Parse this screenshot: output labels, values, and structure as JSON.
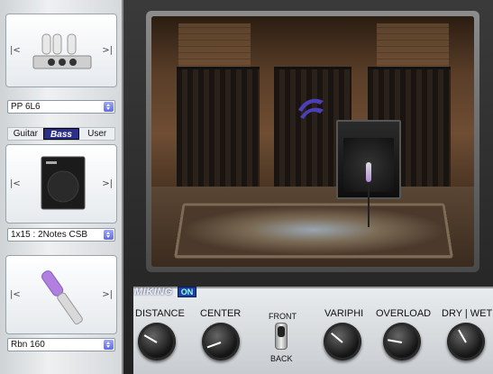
{
  "left": {
    "amp_head": {
      "prev_label": "|<",
      "next_label": ">|",
      "selected": "PP 6L6"
    },
    "cab": {
      "tabs": [
        {
          "label": "Guitar"
        },
        {
          "label": "Bass"
        },
        {
          "label": "User"
        }
      ],
      "active_tab": "Bass",
      "prev_label": "|<",
      "next_label": ">|",
      "selected": "1x15 : 2Notes CSB"
    },
    "mic": {
      "prev_label": "|<",
      "next_label": ">|",
      "selected": "Rbn 160"
    }
  },
  "bottom": {
    "miking_label": "MIKING",
    "miking_state": "ON",
    "knobs": [
      {
        "label": "DISTANCE"
      },
      {
        "label": "CENTER"
      },
      {
        "label": "VARIPHI"
      },
      {
        "label": "OVERLOAD"
      },
      {
        "label": "DRY | WET"
      }
    ],
    "switch_top": "FRONT",
    "switch_bottom": "BACK"
  },
  "colors": {
    "accent": "#2c2f8a",
    "select_arrow": "#5f6ee0"
  },
  "icons": [
    "tube-amp-icon",
    "bass-cabinet-icon",
    "ribbon-mic-icon",
    "2notes-logo-icon"
  ]
}
